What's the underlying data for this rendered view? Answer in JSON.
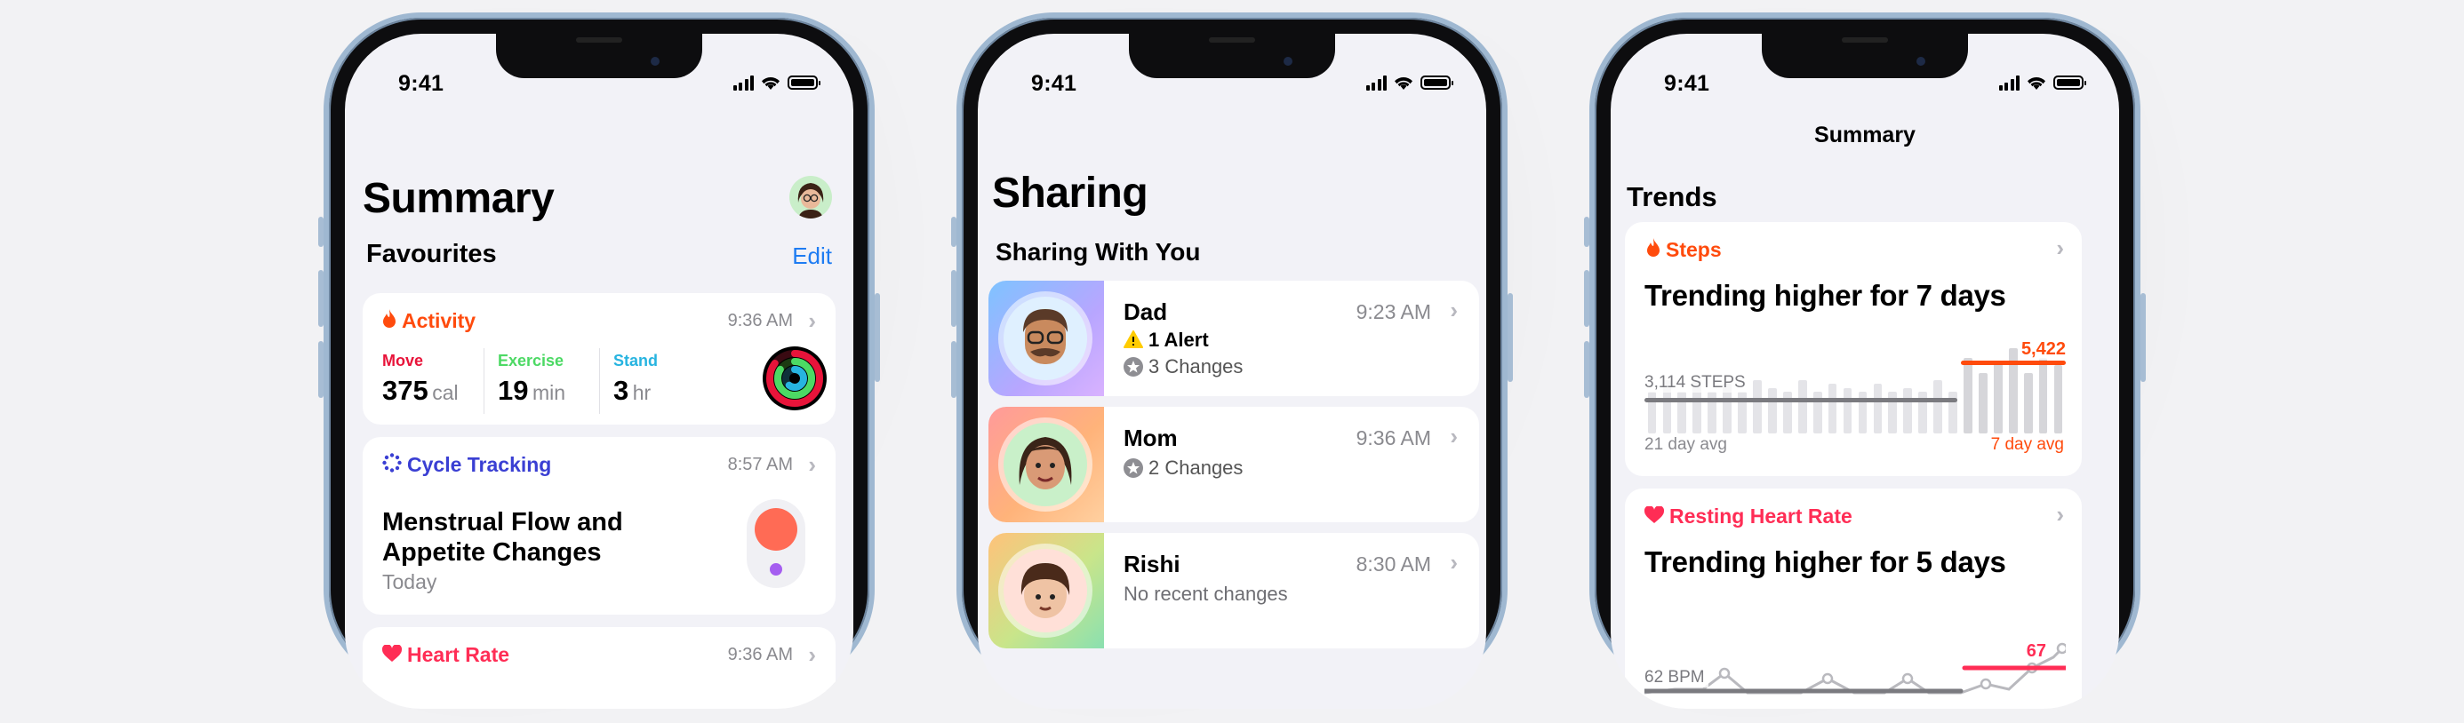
{
  "phone1": {
    "time": "9:41",
    "title": "Summary",
    "favourites_label": "Favourites",
    "edit_label": "Edit",
    "activity": {
      "label": "Activity",
      "time": "9:36 AM",
      "move_label": "Move",
      "move_value": "375",
      "move_unit": "cal",
      "exercise_label": "Exercise",
      "exercise_value": "19",
      "exercise_unit": "min",
      "stand_label": "Stand",
      "stand_value": "3",
      "stand_unit": "hr"
    },
    "cycle": {
      "label": "Cycle Tracking",
      "time": "8:57 AM",
      "heading_line1": "Menstrual Flow and",
      "heading_line2": "Appetite Changes",
      "sub": "Today"
    },
    "heart": {
      "label": "Heart Rate",
      "time": "9:36 AM"
    }
  },
  "phone2": {
    "time": "9:41",
    "title": "Sharing",
    "section_label": "Sharing With You",
    "contacts": [
      {
        "name": "Dad",
        "time": "9:23 AM",
        "alert": "1 Alert",
        "changes": "3 Changes"
      },
      {
        "name": "Mom",
        "time": "9:36 AM",
        "changes": "2 Changes"
      },
      {
        "name": "Rishi",
        "time": "8:30 AM",
        "note": "No recent changes"
      }
    ]
  },
  "phone3": {
    "time": "9:41",
    "nav_title": "Summary",
    "section_label": "Trends",
    "steps": {
      "label": "Steps",
      "heading": "Trending higher for 7 days",
      "avg_label": "3,114 STEPS",
      "recent_value": "5,422",
      "left_caption": "21 day avg",
      "right_caption": "7 day avg",
      "bar_levels": [
        0.49,
        0.62,
        0.49,
        0.62,
        0.49,
        0.58,
        0.49,
        0.62,
        0.53,
        0.49,
        0.62,
        0.49,
        0.58,
        0.53,
        0.49,
        0.58,
        0.49,
        0.53,
        0.49,
        0.62,
        0.49,
        0.89,
        0.71,
        0.84,
        1.0,
        0.71,
        0.89,
        0.8
      ]
    },
    "resting": {
      "label": "Resting Heart Rate",
      "heading": "Trending higher for 5 days",
      "avg_label": "62 BPM",
      "recent_value": "67"
    }
  },
  "colors": {
    "activity": "#ff4b0d",
    "cycle": "#3a3fd3",
    "heart": "#ff2d55",
    "move": "#e8143a",
    "exercise": "#4cd964",
    "stand": "#27b4e0",
    "link": "#1e7cf2",
    "alert": "#ffcc00"
  }
}
